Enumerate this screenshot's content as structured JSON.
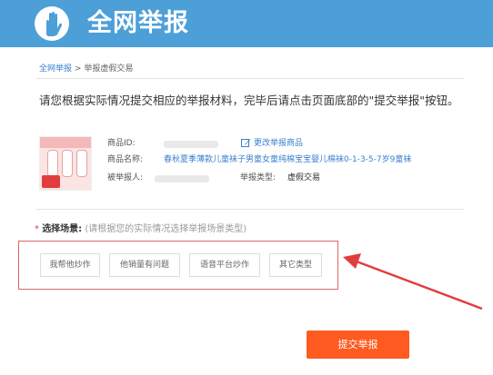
{
  "header": {
    "title": "全网举报",
    "logo_icon": "hand-icon",
    "brand_color": "#4d9fd8"
  },
  "breadcrumb": {
    "home": "全网举报",
    "separator": ">",
    "current": "举报虚假交易"
  },
  "notice": "请您根据实际情况提交相应的举报材料，完毕后请点击页面底部的\"提交举报\"按钮。",
  "product": {
    "image_icon": "product-socks-image",
    "id_label": "商品ID:",
    "edit_label": "更改举报商品",
    "name_label": "商品名称:",
    "name_value": "春秋夏季薄款儿童袜子男童女童纯棉宝宝婴儿棉袜0-1-3-5-7岁9童袜",
    "reporter_label": "被举报人:",
    "type_label": "举报类型:",
    "type_value": "虚假交易"
  },
  "scene": {
    "required_mark": "*",
    "title": "选择场景:",
    "hint": "(请根据您的实际情况选择举报场景类型)",
    "options": [
      "我帮他炒作",
      "他销量有问题",
      "语音平台炒作",
      "其它类型"
    ]
  },
  "submit_label": "提交举报",
  "colors": {
    "accent": "#ff5a1f",
    "annotation": "#e23d3d",
    "link": "#3a7fcf"
  }
}
